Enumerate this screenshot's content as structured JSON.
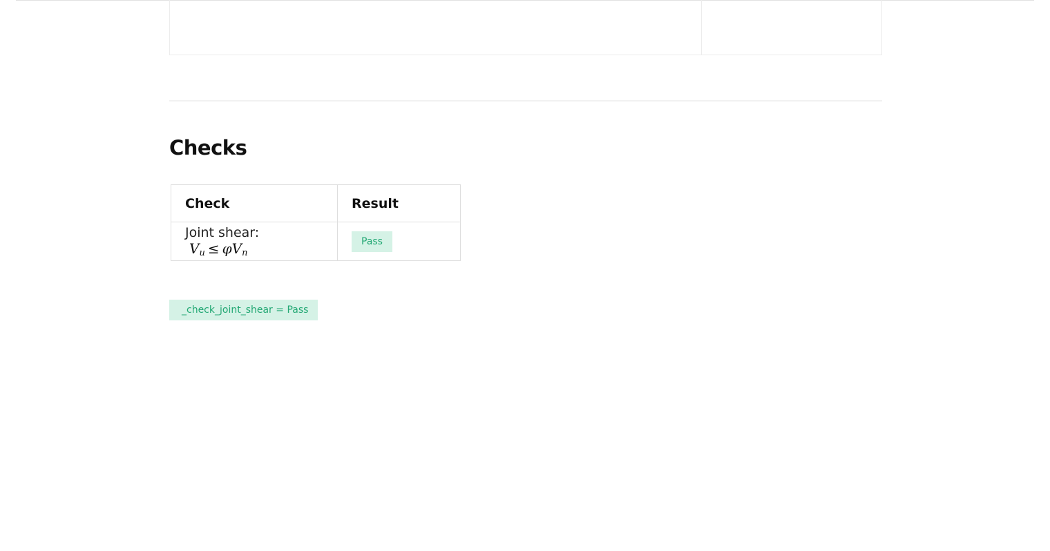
{
  "section": {
    "title": "Checks"
  },
  "checks_table": {
    "headers": {
      "check": "Check",
      "result": "Result"
    },
    "rows": [
      {
        "label": "Joint shear:",
        "formula": {
          "lhs_symbol": "V",
          "lhs_sub": "u",
          "operator": "≤",
          "phi": "φ",
          "rhs_symbol": "V",
          "rhs_sub": "n"
        },
        "result": "Pass"
      }
    ]
  },
  "output": {
    "text": "_check_joint_shear = Pass"
  },
  "colors": {
    "pass_bg": "#d5f2e6",
    "pass_text": "#23a874"
  }
}
